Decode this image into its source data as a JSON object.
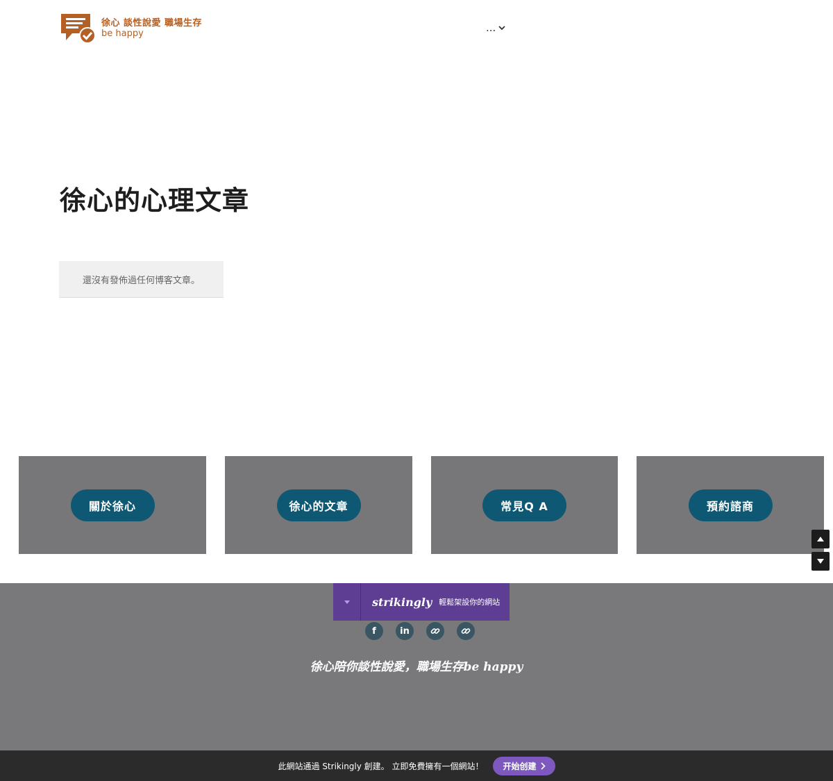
{
  "header": {
    "logo_line1": "徐心 談性說愛 職場生存",
    "logo_line2": "be happy",
    "nav_more": "..."
  },
  "main": {
    "title": "徐心的心理文章",
    "empty_notice": "還沒有發佈過任何博客文章。"
  },
  "cards": [
    {
      "label": "關於徐心"
    },
    {
      "label": "徐心的文章"
    },
    {
      "label": "常見Q A"
    },
    {
      "label": "預約諮商"
    }
  ],
  "footer": {
    "strikingly_brand": "strikingly",
    "strikingly_tagline": "輕鬆架設你的網站",
    "socials": [
      {
        "icon": "facebook-icon",
        "glyph": "f"
      },
      {
        "icon": "linkedin-icon",
        "glyph": "in"
      },
      {
        "icon": "link-icon"
      },
      {
        "icon": "link-icon"
      }
    ],
    "tagline": "徐心陪你談性說愛，職場生存be happy"
  },
  "bottom_bar": {
    "text": "此網站通過 Strikingly 創建。 立即免費擁有一個網站！",
    "cta": "开始创建"
  },
  "colors": {
    "brand_orange": "#b45f24",
    "card_gray": "#777779",
    "button_teal": "#0e5873",
    "strikingly_purple": "#5e3e93",
    "cta_purple": "#7d58be"
  }
}
